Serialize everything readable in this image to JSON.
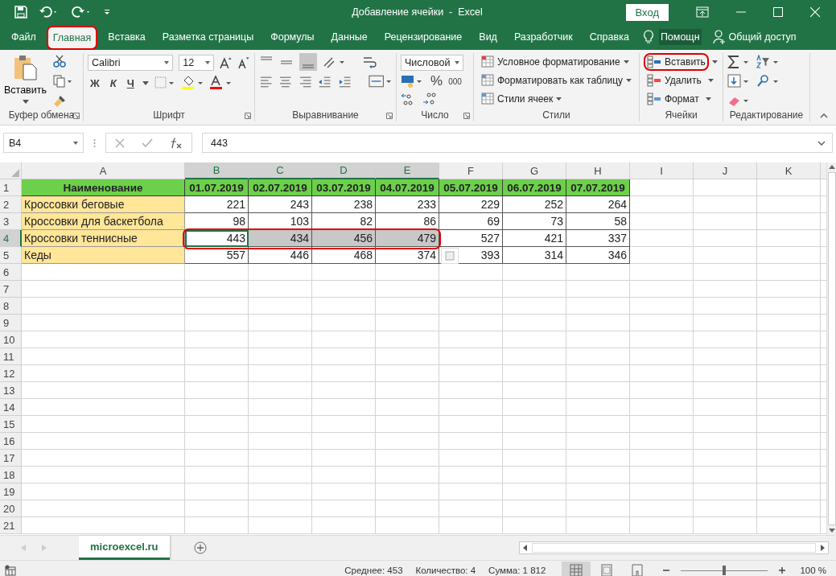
{
  "title_bar": {
    "title": "Добавление ячейки  -  Excel",
    "sign_in": "Вход"
  },
  "tabs": [
    {
      "label": "Файл",
      "selected": false,
      "highlighted": false
    },
    {
      "label": "Главная",
      "selected": true,
      "highlighted": true
    },
    {
      "label": "Вставка",
      "selected": false,
      "highlighted": false
    },
    {
      "label": "Разметка страницы",
      "selected": false,
      "highlighted": false
    },
    {
      "label": "Формулы",
      "selected": false,
      "highlighted": false
    },
    {
      "label": "Данные",
      "selected": false,
      "highlighted": false
    },
    {
      "label": "Рецензирование",
      "selected": false,
      "highlighted": false
    },
    {
      "label": "Вид",
      "selected": false,
      "highlighted": false
    },
    {
      "label": "Разработчик",
      "selected": false,
      "highlighted": false
    },
    {
      "label": "Справка",
      "selected": false,
      "highlighted": false
    }
  ],
  "tell_me": "Помощн",
  "share": "Общий доступ",
  "ribbon": {
    "clipboard": {
      "label": "Буфер обмена",
      "paste": "Вставить"
    },
    "font": {
      "label": "Шрифт",
      "font_name": "Calibri",
      "font_size": "12",
      "bold": "Ж",
      "italic": "К",
      "underline": "Ч"
    },
    "alignment": {
      "label": "Выравнивание"
    },
    "number": {
      "label": "Число",
      "format": "Числовой",
      "percent": "%",
      "thousands": "000"
    },
    "styles": {
      "label": "Стили",
      "items": [
        "Условное форматирование",
        "Форматировать как таблицу",
        "Стили ячеек"
      ]
    },
    "cells": {
      "label": "Ячейки",
      "items": [
        {
          "label": "Вставить",
          "highlighted": true
        },
        {
          "label": "Удалить",
          "highlighted": false
        },
        {
          "label": "Формат",
          "highlighted": false
        }
      ]
    },
    "editing": {
      "label": "Редактирование"
    }
  },
  "formula_bar": {
    "name_box": "B4",
    "value": "443"
  },
  "sheet": {
    "columns": [
      {
        "label": "A",
        "selected": false
      },
      {
        "label": "B",
        "selected": true
      },
      {
        "label": "C",
        "selected": true
      },
      {
        "label": "D",
        "selected": true
      },
      {
        "label": "E",
        "selected": true
      },
      {
        "label": "F",
        "selected": false
      },
      {
        "label": "G",
        "selected": false
      },
      {
        "label": "H",
        "selected": false
      },
      {
        "label": "I",
        "selected": false
      },
      {
        "label": "J",
        "selected": false
      },
      {
        "label": "K",
        "selected": false
      }
    ],
    "rows": [
      {
        "number": "1",
        "kind": "header",
        "selected": false,
        "highlighted": false,
        "cells": [
          {
            "text": "Наименование",
            "selected": false
          },
          {
            "text": "01.07.2019",
            "selected": false
          },
          {
            "text": "02.07.2019",
            "selected": false
          },
          {
            "text": "03.07.2019",
            "selected": false
          },
          {
            "text": "04.07.2019",
            "selected": false
          },
          {
            "text": "05.07.2019",
            "selected": false
          },
          {
            "text": "06.07.2019",
            "selected": false
          },
          {
            "text": "07.07.2019",
            "selected": false
          }
        ]
      },
      {
        "number": "2",
        "kind": "data",
        "selected": false,
        "highlighted": false,
        "cells": [
          {
            "text": "Кроссовки беговые",
            "selected": false
          },
          {
            "text": "221",
            "selected": false
          },
          {
            "text": "243",
            "selected": false
          },
          {
            "text": "238",
            "selected": false
          },
          {
            "text": "233",
            "selected": false
          },
          {
            "text": "229",
            "selected": false
          },
          {
            "text": "252",
            "selected": false
          },
          {
            "text": "264",
            "selected": false
          }
        ]
      },
      {
        "number": "3",
        "kind": "data",
        "selected": false,
        "highlighted": false,
        "cells": [
          {
            "text": "Кроссовки для баскетбола",
            "selected": false
          },
          {
            "text": "98",
            "selected": false
          },
          {
            "text": "103",
            "selected": false
          },
          {
            "text": "82",
            "selected": false
          },
          {
            "text": "86",
            "selected": false
          },
          {
            "text": "69",
            "selected": false
          },
          {
            "text": "73",
            "selected": false
          },
          {
            "text": "58",
            "selected": false
          }
        ]
      },
      {
        "number": "4",
        "kind": "data",
        "selected": true,
        "highlighted": true,
        "cells": [
          {
            "text": "Кроссовки теннисные",
            "selected": false
          },
          {
            "text": "443",
            "selected": true
          },
          {
            "text": "434",
            "selected": true
          },
          {
            "text": "456",
            "selected": true
          },
          {
            "text": "479",
            "selected": true
          },
          {
            "text": "527",
            "selected": false
          },
          {
            "text": "421",
            "selected": false
          },
          {
            "text": "337",
            "selected": false
          }
        ]
      },
      {
        "number": "5",
        "kind": "data",
        "selected": false,
        "highlighted": false,
        "cells": [
          {
            "text": "Кеды",
            "selected": false
          },
          {
            "text": "557",
            "selected": false
          },
          {
            "text": "446",
            "selected": false
          },
          {
            "text": "468",
            "selected": false
          },
          {
            "text": "374",
            "selected": false
          },
          {
            "text": "393",
            "selected": false
          },
          {
            "text": "314",
            "selected": false
          },
          {
            "text": "346",
            "selected": false
          }
        ]
      },
      {
        "number": "6",
        "kind": "empty",
        "selected": false,
        "highlighted": false
      },
      {
        "number": "7",
        "kind": "empty",
        "selected": false,
        "highlighted": false
      },
      {
        "number": "8",
        "kind": "empty",
        "selected": false,
        "highlighted": false
      },
      {
        "number": "9",
        "kind": "empty",
        "selected": false,
        "highlighted": false
      },
      {
        "number": "10",
        "kind": "empty",
        "selected": false,
        "highlighted": false
      },
      {
        "number": "11",
        "kind": "empty",
        "selected": false,
        "highlighted": false
      },
      {
        "number": "12",
        "kind": "empty",
        "selected": false,
        "highlighted": false
      },
      {
        "number": "13",
        "kind": "empty",
        "selected": false,
        "highlighted": false
      },
      {
        "number": "14",
        "kind": "empty",
        "selected": false,
        "highlighted": false
      },
      {
        "number": "15",
        "kind": "empty",
        "selected": false,
        "highlighted": false
      },
      {
        "number": "16",
        "kind": "empty",
        "selected": false,
        "highlighted": false
      },
      {
        "number": "17",
        "kind": "empty",
        "selected": false,
        "highlighted": false
      },
      {
        "number": "18",
        "kind": "empty",
        "selected": false,
        "highlighted": false
      },
      {
        "number": "19",
        "kind": "empty",
        "selected": false,
        "highlighted": false
      },
      {
        "number": "20",
        "kind": "empty",
        "selected": false,
        "highlighted": false
      },
      {
        "number": "21",
        "kind": "empty",
        "selected": false,
        "highlighted": false
      }
    ]
  },
  "sheet_tabs": [
    {
      "label": "microexcel.ru",
      "selected": true
    }
  ],
  "status_bar": {
    "stats": [
      "Среднее: 453",
      "Количество: 4",
      "Сумма: 1 812"
    ],
    "zoom": "100 %",
    "zoom_level": {
      "level": 0.5
    }
  }
}
